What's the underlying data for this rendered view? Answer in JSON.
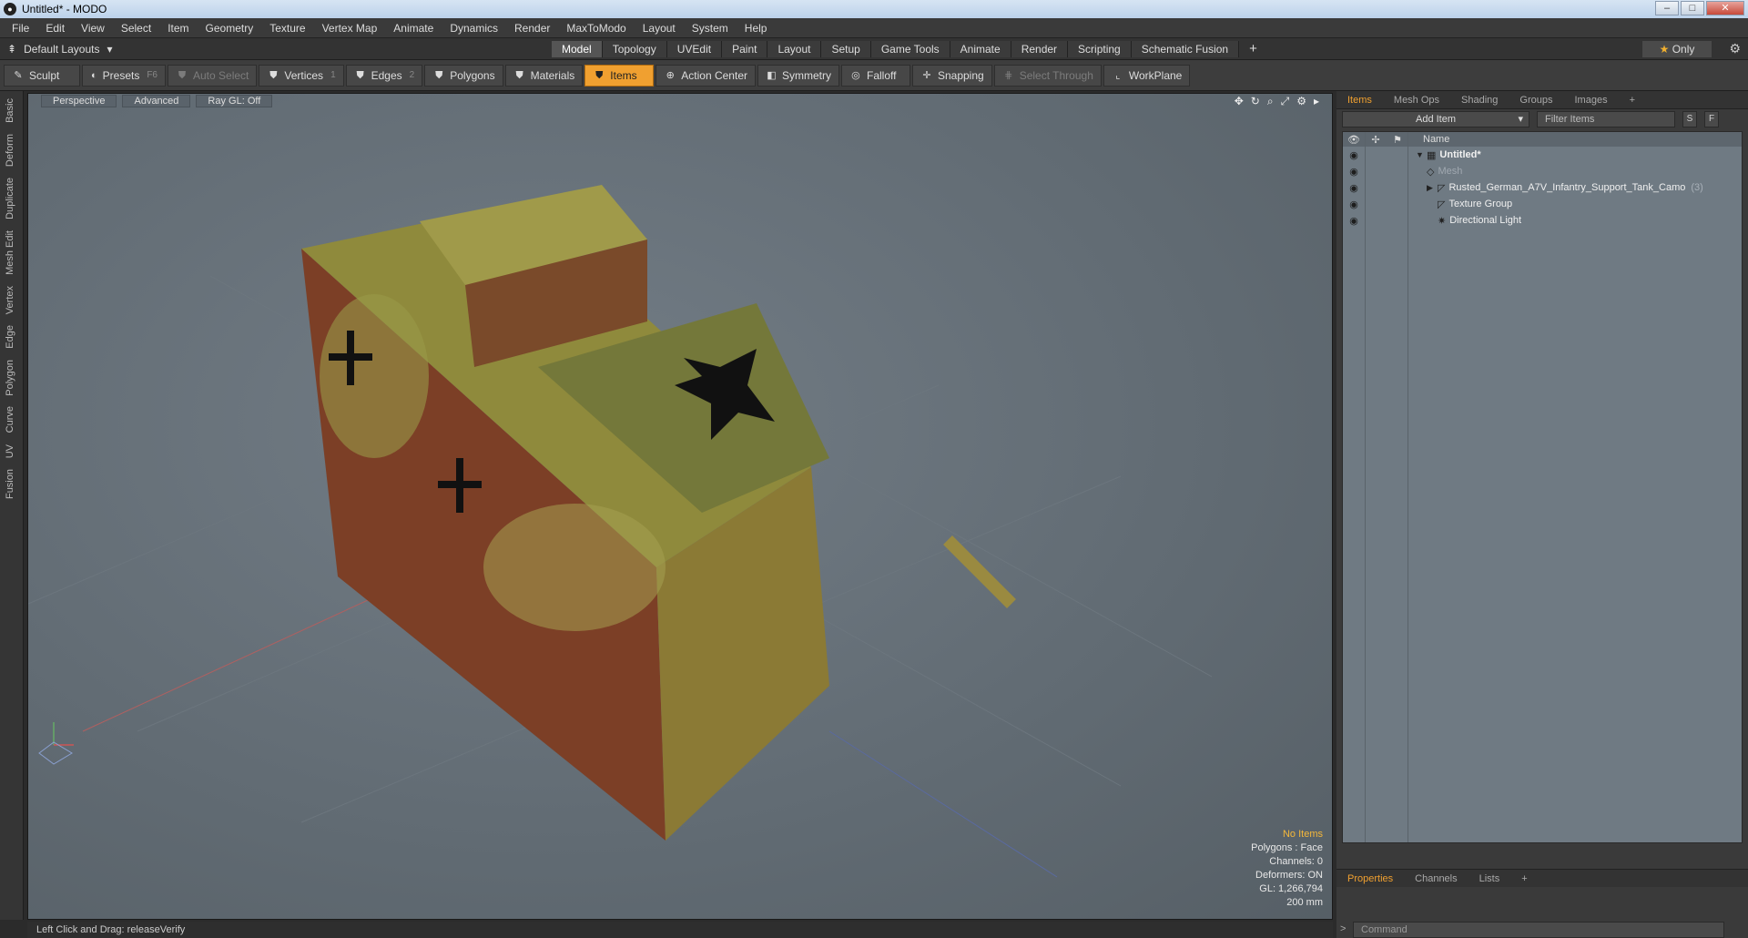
{
  "window": {
    "title": "Untitled* - MODO",
    "app_icon": "modo-logo-icon"
  },
  "menu": [
    "File",
    "Edit",
    "View",
    "Select",
    "Item",
    "Geometry",
    "Texture",
    "Vertex Map",
    "Animate",
    "Dynamics",
    "Render",
    "MaxToModo",
    "Layout",
    "System",
    "Help"
  ],
  "layout": {
    "selector": "Default Layouts",
    "tabs": [
      "Model",
      "Topology",
      "UVEdit",
      "Paint",
      "Layout",
      "Setup",
      "Game Tools",
      "Animate",
      "Render",
      "Scripting",
      "Schematic Fusion"
    ],
    "active_tab": "Model",
    "only_label": "Only"
  },
  "toolbar": {
    "sculpt": "Sculpt",
    "presets": "Presets",
    "presets_key": "F6",
    "auto_select": "Auto Select",
    "vertices": "Vertices",
    "vertices_key": "1",
    "edges": "Edges",
    "edges_key": "2",
    "polygons": "Polygons",
    "materials": "Materials",
    "items": "Items",
    "action_center": "Action Center",
    "symmetry": "Symmetry",
    "falloff": "Falloff",
    "snapping": "Snapping",
    "select_through": "Select Through",
    "workplane": "WorkPlane"
  },
  "left_tabs": [
    "Basic",
    "Deform",
    "Duplicate",
    "Mesh Edit",
    "Vertex",
    "Edge",
    "Polygon",
    "Curve",
    "UV",
    "Fusion"
  ],
  "viewport": {
    "view_mode": "Perspective",
    "shading": "Advanced",
    "raygl": "Ray GL: Off",
    "info": {
      "selection": "No Items",
      "polygons": "Polygons : Face",
      "channels": "Channels: 0",
      "deformers": "Deformers: ON",
      "gl": "GL: 1,266,794",
      "grid": "200 mm"
    }
  },
  "status": {
    "text": "Left Click and Drag:  releaseVerify"
  },
  "items_panel": {
    "tabs": [
      "Items",
      "Mesh Ops",
      "Shading",
      "Groups",
      "Images"
    ],
    "active_tab": "Items",
    "add_item": "Add Item",
    "filter_placeholder": "Filter Items",
    "btn_s": "S",
    "btn_f": "F",
    "column_name": "Name",
    "tree": [
      {
        "label": "Untitled*",
        "bold": true
      },
      {
        "label": "Mesh",
        "dim": true
      },
      {
        "label": "Rusted_German_A7V_Infantry_Support_Tank_Camo",
        "count": "(3)"
      },
      {
        "label": "Texture Group"
      },
      {
        "label": "Directional Light"
      }
    ]
  },
  "properties_panel": {
    "tabs": [
      "Properties",
      "Channels",
      "Lists"
    ],
    "active_tab": "Properties",
    "command_placeholder": "Command"
  },
  "colors": {
    "accent": "#f0a030",
    "viewport_bg": "#66707a",
    "tank_camo_green": "#8f9a44",
    "tank_rust": "#7c3f26"
  }
}
